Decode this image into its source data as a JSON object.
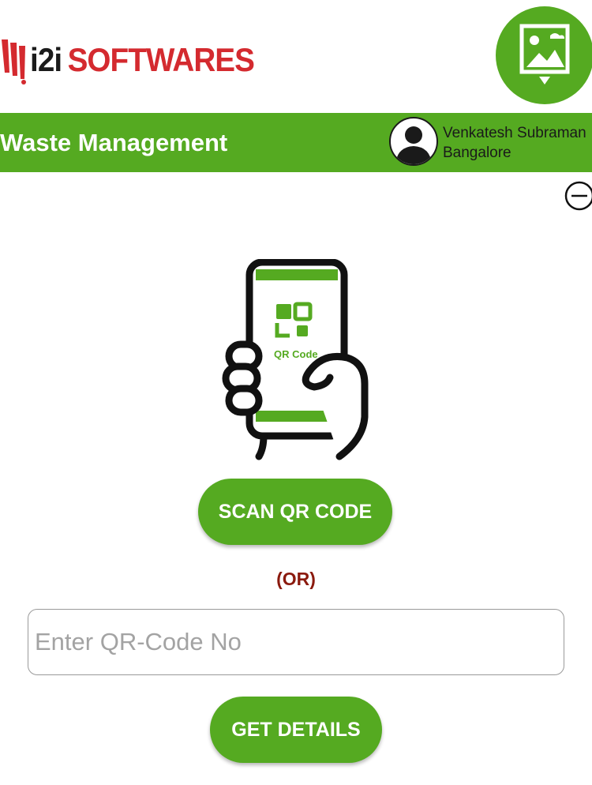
{
  "brand": {
    "name_part1": "i2i",
    "name_part2": "SOFTWARES",
    "colors": {
      "dark": "#1b1b1b",
      "red": "#d42a2f"
    }
  },
  "header": {
    "title": "Waste Management",
    "user": {
      "name": "Venkatesh Subraman",
      "location": "Bangalore"
    },
    "photo_button_icon": "image-picker-icon",
    "logout_icon": "logout-icon"
  },
  "illustration": {
    "icon": "hand-holding-phone-icon",
    "screen_label": "QR Code"
  },
  "actions": {
    "scan_label": "SCAN QR CODE",
    "or_label": "(OR)",
    "qr_input": {
      "placeholder": "Enter QR-Code No",
      "value": ""
    },
    "get_details_label": "GET DETAILS"
  },
  "colors": {
    "primary_green": "#55aa21",
    "or_text": "#8b1a0e",
    "white": "#ffffff"
  }
}
